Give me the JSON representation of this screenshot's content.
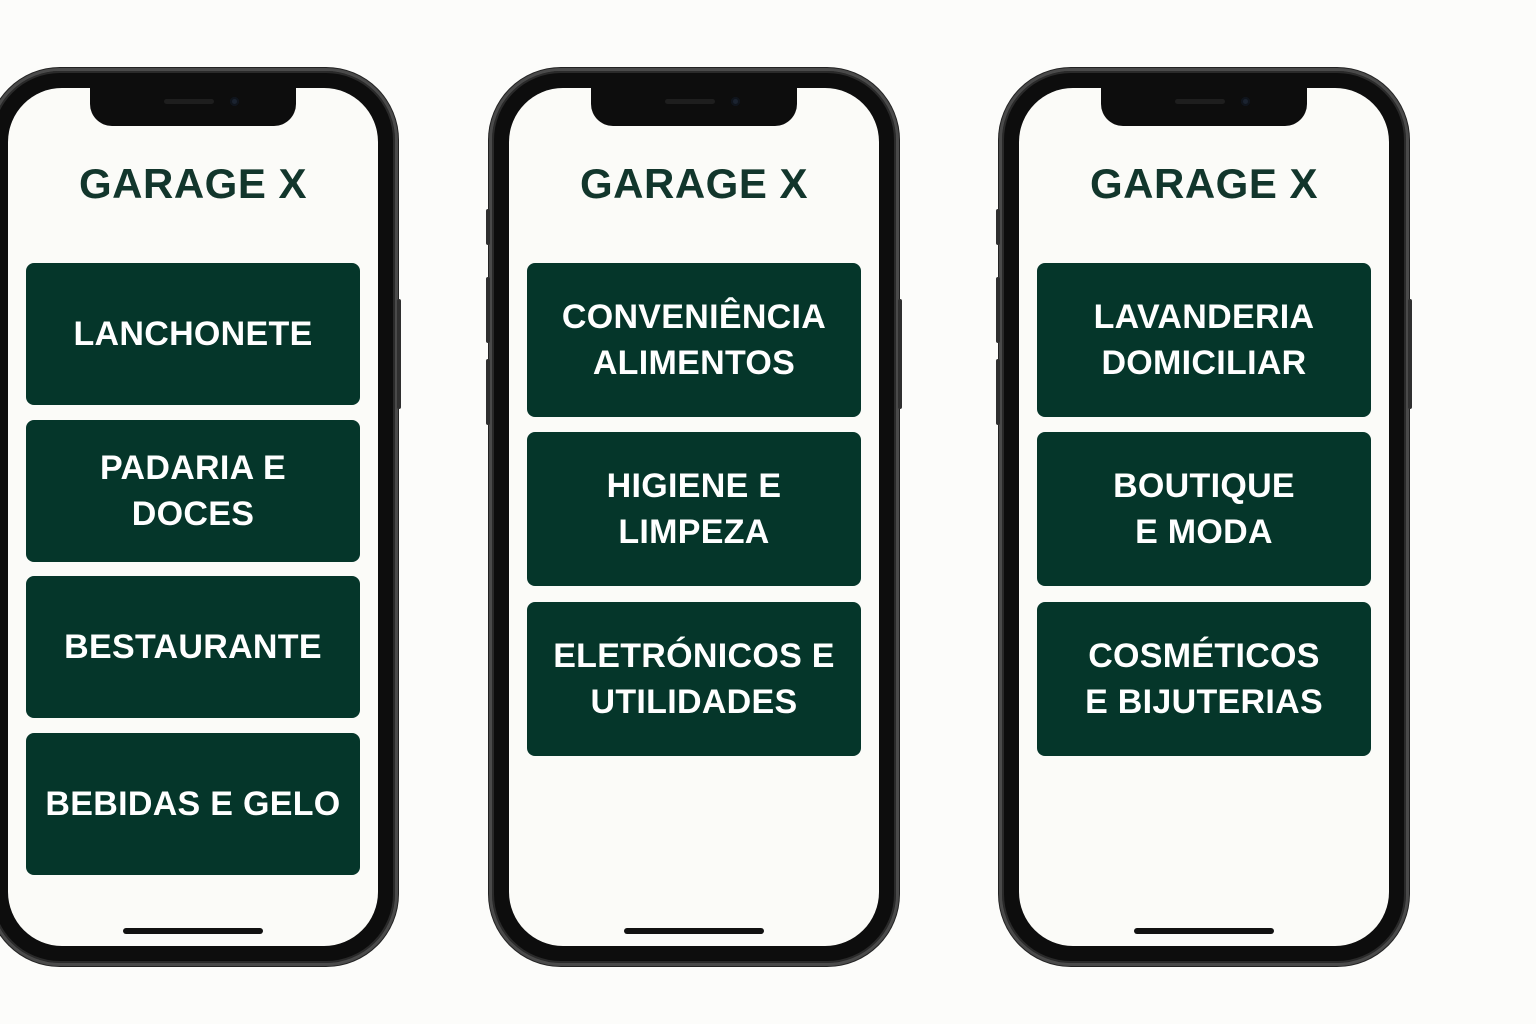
{
  "phones": [
    {
      "title": "GARAGE X",
      "buttons": [
        {
          "label": "LANCHONETE"
        },
        {
          "label": "PADARIA E DOCES"
        },
        {
          "label": "BESTAURANTE"
        },
        {
          "label": "BEBIDAS E GELO"
        }
      ]
    },
    {
      "title": "GARAGE X",
      "buttons": [
        {
          "label": "CONVENIÊNCIA\nALIMENTOS"
        },
        {
          "label": "HIGIENE E\nLIMPEZA"
        },
        {
          "label": "ELETRÓNICOS E\nUTILIDADES"
        }
      ]
    },
    {
      "title": "GARAGE X",
      "buttons": [
        {
          "label": "LAVANDERIA\nDOMICILIAR"
        },
        {
          "label": "BOUTIQUE\nE MODA"
        },
        {
          "label": "COSMÉTICOS\nE BIJUTERIAS"
        }
      ]
    }
  ],
  "colors": {
    "brand_dark_green": "#05362a",
    "title_green": "#12362c",
    "screen_background": "#fbfbf8",
    "phone_frame": "#0d0d0d"
  }
}
